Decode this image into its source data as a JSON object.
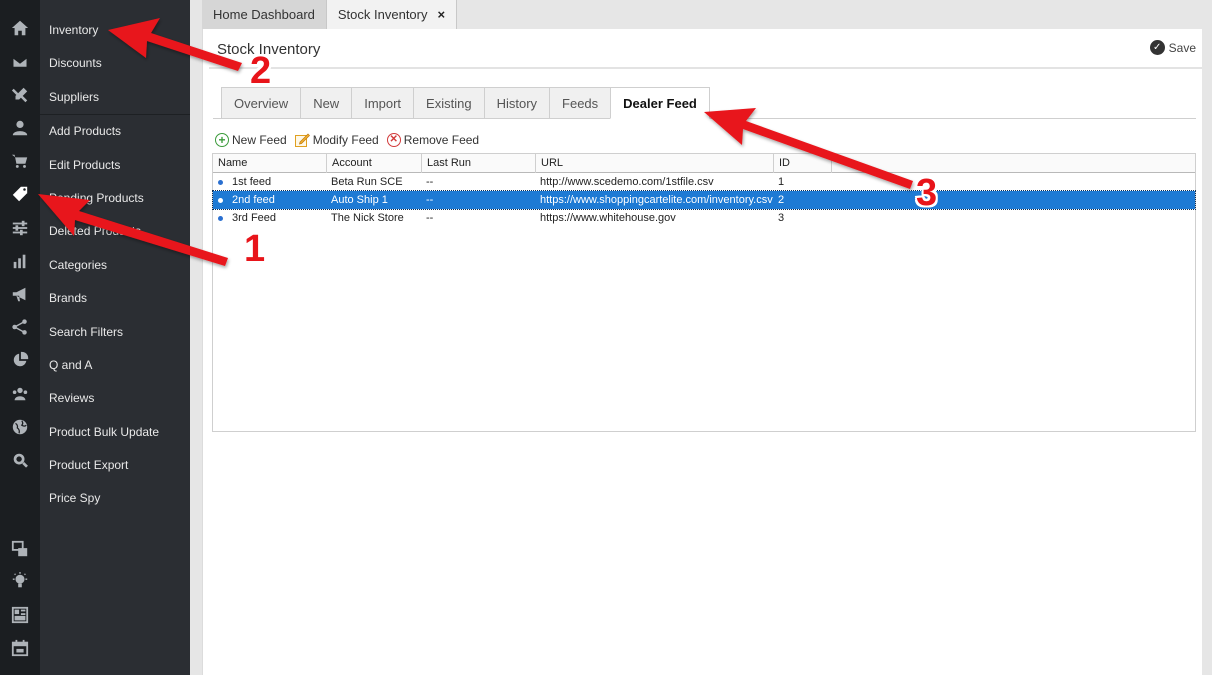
{
  "rail_icons": [
    "home-icon",
    "mail-icon",
    "tools-icon",
    "user-icon",
    "cart-icon",
    "tag-icon",
    "sliders-icon",
    "bar-chart-icon",
    "megaphone-icon",
    "share-icon",
    "pie-chart-icon",
    "users-icon",
    "globe-icon",
    "gear-search-icon",
    "windows-icon",
    "lightbulb-icon",
    "layout-icon",
    "calendar-icon"
  ],
  "sidebar": {
    "items": [
      {
        "label": "Inventory"
      },
      {
        "label": "Discounts"
      },
      {
        "label": "Suppliers"
      },
      {
        "label": "Add Products"
      },
      {
        "label": "Edit Products"
      },
      {
        "label": "Pending Products"
      },
      {
        "label": "Deleted Products"
      },
      {
        "label": "Categories"
      },
      {
        "label": "Brands"
      },
      {
        "label": "Search Filters"
      },
      {
        "label": "Q and A"
      },
      {
        "label": "Reviews"
      },
      {
        "label": "Product Bulk Update"
      },
      {
        "label": "Product Export"
      },
      {
        "label": "Price Spy"
      }
    ]
  },
  "doc_tabs": [
    {
      "label": "Home Dashboard"
    },
    {
      "label": "Stock Inventory",
      "close": "×"
    }
  ],
  "page": {
    "title": "Stock Inventory",
    "save_label": "Save",
    "save_icon": "✓"
  },
  "subtabs": [
    {
      "label": "Overview"
    },
    {
      "label": "New"
    },
    {
      "label": "Import"
    },
    {
      "label": "Existing"
    },
    {
      "label": "History"
    },
    {
      "label": "Feeds"
    },
    {
      "label": "Dealer Feed"
    }
  ],
  "toolbar": {
    "new_label": "New Feed",
    "new_icon": "+",
    "modify_label": "Modify Feed",
    "remove_label": "Remove Feed",
    "remove_icon": "✕"
  },
  "table": {
    "columns": [
      "Name",
      "Account",
      "Last Run",
      "URL",
      "ID"
    ],
    "rows": [
      {
        "name": "1st feed",
        "account": "Beta Run SCE",
        "last_run": "--",
        "url": "http://www.scedemo.com/1stfile.csv",
        "id": "1"
      },
      {
        "name": "2nd feed",
        "account": "Auto Ship 1",
        "last_run": "--",
        "url": "https://www.shoppingcartelite.com/inventory.csv",
        "id": "2"
      },
      {
        "name": "3rd Feed",
        "account": "The Nick Store",
        "last_run": "--",
        "url": "https://www.whitehouse.gov",
        "id": "3"
      }
    ]
  },
  "annotations": {
    "color": "#e8141a",
    "labels": [
      "1",
      "2",
      "3"
    ]
  }
}
